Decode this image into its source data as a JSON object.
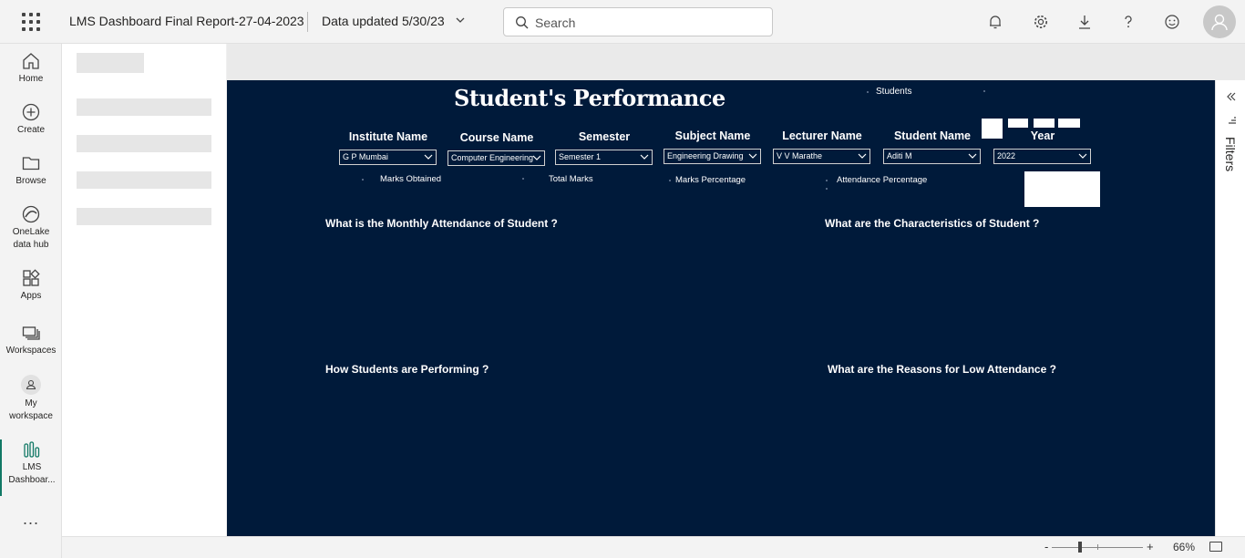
{
  "header": {
    "report_title": "LMS Dashboard Final Report-27-04-2023",
    "data_updated": "Data updated 5/30/23",
    "search_placeholder": "Search"
  },
  "nav": {
    "items": [
      {
        "label": "Home",
        "icon": "home-icon"
      },
      {
        "label": "Create",
        "icon": "plus-circle-icon"
      },
      {
        "label": "Browse",
        "icon": "folder-icon"
      },
      {
        "label": "OneLake data hub",
        "line1": "OneLake",
        "line2": "data hub",
        "icon": "onelake-icon"
      },
      {
        "label": "Apps",
        "icon": "apps-icon"
      },
      {
        "label": "Workspaces",
        "icon": "workspaces-icon"
      },
      {
        "label": "My workspace",
        "line1": "My",
        "line2": "workspace",
        "icon": "person-icon"
      },
      {
        "label": "LMS Dashboar...",
        "line1": "LMS",
        "line2": "Dashboar...",
        "icon": "report-icon"
      }
    ],
    "more": "..."
  },
  "report": {
    "title": "Student's Performance",
    "students_label": "Students",
    "slicers": [
      {
        "label": "Institute Name",
        "value": "G P Mumbai"
      },
      {
        "label": "Course Name",
        "value": "Computer Engineering"
      },
      {
        "label": "Semester",
        "value": "Semester 1"
      },
      {
        "label": "Subject Name",
        "value": "Engineering Drawing"
      },
      {
        "label": "Lecturer Name",
        "value": "V V Marathe"
      },
      {
        "label": "Student Name",
        "value": "Aditi M"
      },
      {
        "label": "Year",
        "value": "2022"
      }
    ],
    "cards": [
      "Marks Obtained",
      "Total Marks",
      "Marks Percentage",
      "Attendance Percentage"
    ],
    "questions": [
      "What is the Monthly Attendance of Student ?",
      "What are the Characteristics of Student ?",
      "How Students are Performing ?",
      "What are the Reasons for Low Attendance ?"
    ]
  },
  "filters": {
    "label": "Filters"
  },
  "status": {
    "zoom": "66%",
    "minus": "-",
    "plus": "+"
  }
}
